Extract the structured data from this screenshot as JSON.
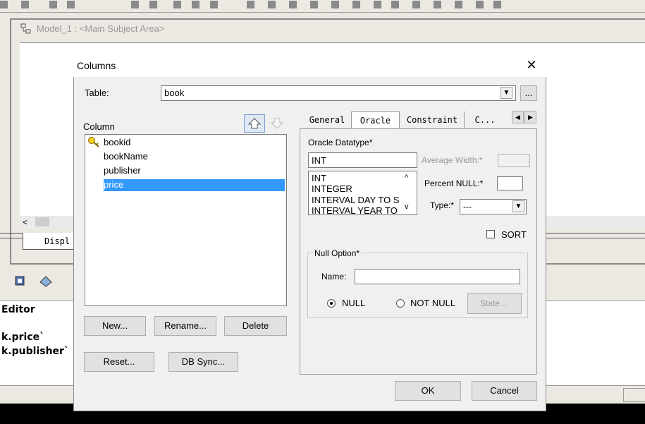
{
  "model_window": {
    "title": "Model_1 : <Main Subject Area>",
    "display_tab": "Displ"
  },
  "editor": {
    "label": "Editor",
    "lines": [
      "k.price`",
      "k.publisher`"
    ]
  },
  "dialog": {
    "title": "Columns",
    "close_label": "✕",
    "table_label": "Table:",
    "table_value": "book",
    "ellipsis_label": "...",
    "column_label": "Column",
    "columns": [
      {
        "name": "bookid",
        "key": true
      },
      {
        "name": "bookName",
        "key": false
      },
      {
        "name": "publisher",
        "key": false
      },
      {
        "name": "price",
        "key": false
      }
    ],
    "selected_column": "price",
    "buttons": {
      "new": "New...",
      "rename": "Rename...",
      "delete": "Delete",
      "reset": "Reset...",
      "db_sync": "DB Sync...",
      "ok": "OK",
      "cancel": "Cancel"
    },
    "tabs": [
      "General",
      "Oracle",
      "Constraint",
      "C..."
    ],
    "active_tab": "Oracle",
    "oracle": {
      "datatype_label": "Oracle Datatype*",
      "datatype_value": "INT",
      "datatype_options": [
        "INT",
        "INTEGER",
        "INTERVAL DAY TO S",
        "INTERVAL YEAR TO"
      ],
      "avg_width_label": "Average Width:*",
      "avg_width_value": "",
      "percent_null_label": "Percent NULL:*",
      "percent_null_value": "",
      "type_label": "Type:*",
      "type_value": "---",
      "sort_label": "SORT",
      "null_option_label": "Null Option*",
      "name_label": "Name:",
      "name_value": "",
      "null_label": "NULL",
      "not_null_label": "NOT NULL",
      "state_label": "State ..."
    }
  },
  "colors": {
    "selection": "#3399ff",
    "dialog_bg": "#f0f0f0"
  }
}
